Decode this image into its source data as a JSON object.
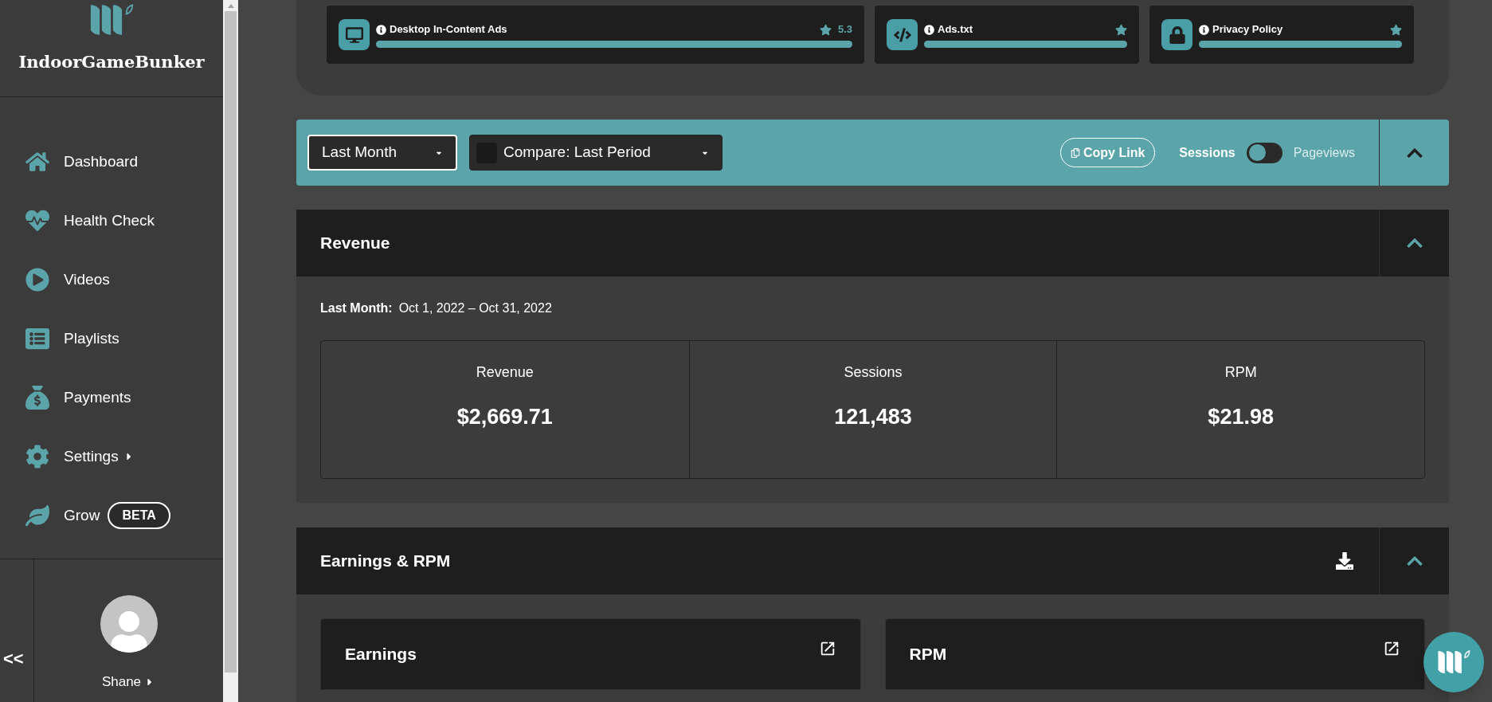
{
  "sidebar": {
    "brand": "IndoorGameBunker",
    "items": [
      {
        "kind": "home",
        "label": "Dashboard",
        "caret": false
      },
      {
        "kind": "health",
        "label": "Health Check",
        "caret": false
      },
      {
        "kind": "videos",
        "label": "Videos",
        "caret": false
      },
      {
        "kind": "playlists",
        "label": "Playlists",
        "caret": false
      },
      {
        "kind": "payments",
        "label": "Payments",
        "caret": false
      },
      {
        "kind": "settings",
        "label": "Settings",
        "caret": true
      },
      {
        "kind": "grow",
        "label": "Grow",
        "caret": false,
        "badge": "BETA"
      }
    ],
    "collapse": "<<",
    "user": "Shane"
  },
  "checks": [
    {
      "kind": "ads",
      "title": "Desktop In-Content Ads",
      "score": "5.3",
      "level": 1
    },
    {
      "kind": "adstxt",
      "title": "Ads.txt",
      "level": 1
    },
    {
      "kind": "privacy",
      "title": "Privacy Policy",
      "level": 1
    }
  ],
  "toolbar": {
    "period": "Last Month",
    "compare": {
      "checked": false,
      "label": "Compare: Last Period"
    },
    "copy_link": "Copy Link",
    "toggle": {
      "left": "Sessions",
      "right": "Pageviews",
      "on": false
    }
  },
  "revenue": {
    "title": "Revenue",
    "period_label": "Last Month:",
    "period": "Oct 1, 2022 – Oct 31, 2022",
    "stats": [
      {
        "label": "Revenue",
        "value": "$2,669.71"
      },
      {
        "label": "Sessions",
        "value": "121,483"
      },
      {
        "label": "RPM",
        "value": "$21.98"
      }
    ]
  },
  "earnings": {
    "title": "Earnings & RPM",
    "cards": [
      "Earnings",
      "RPM"
    ]
  }
}
